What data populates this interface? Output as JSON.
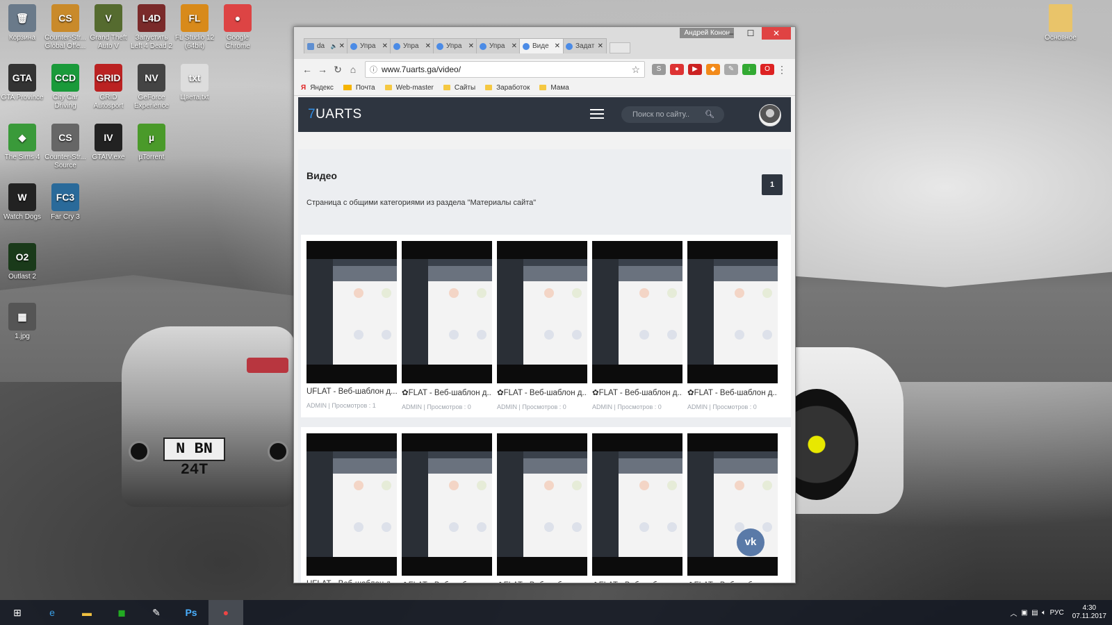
{
  "desktop": {
    "icons": [
      {
        "label": "Корзина",
        "abbr": "🗑",
        "color": "#6a7a8a"
      },
      {
        "label": "Counter-Str... Global Offe...",
        "abbr": "CS",
        "color": "#c98a2a"
      },
      {
        "label": "Grand Theft Auto V",
        "abbr": "V",
        "color": "#556b2f"
      },
      {
        "label": "Запустить Left 4 Dead 2",
        "abbr": "L4D",
        "color": "#7a2a2a"
      },
      {
        "label": "FL Studio 12 (64bit)",
        "abbr": "FL",
        "color": "#d88a1a"
      },
      {
        "label": "Google Chrome",
        "abbr": "●",
        "color": "#d44"
      },
      {
        "label": "GTA Province",
        "abbr": "GTA",
        "color": "#333"
      },
      {
        "label": "City Car Driving",
        "abbr": "CCD",
        "color": "#1a9a3a"
      },
      {
        "label": "GRID Autosport",
        "abbr": "GRID",
        "color": "#b22"
      },
      {
        "label": "GeForce Experience",
        "abbr": "NV",
        "color": "#444"
      },
      {
        "label": "Цвета.txt",
        "abbr": "txt",
        "color": "#ddd"
      },
      {
        "label": "The Sims 4",
        "abbr": "◆",
        "color": "#3a9a3a"
      },
      {
        "label": "Counter-Str... Source",
        "abbr": "CS",
        "color": "#666"
      },
      {
        "label": "GTAIV.exe",
        "abbr": "IV",
        "color": "#222"
      },
      {
        "label": "µTorrent",
        "abbr": "µ",
        "color": "#4a9a2a"
      },
      {
        "label": "Watch Dogs",
        "abbr": "W",
        "color": "#222"
      },
      {
        "label": "Far Cry 3",
        "abbr": "FC3",
        "color": "#2a6a9a"
      },
      {
        "label": "Outlast 2",
        "abbr": "O2",
        "color": "#1a3a1a"
      },
      {
        "label": "1.jpg",
        "abbr": "▦",
        "color": "#555"
      }
    ],
    "top_right_icon": "Основное"
  },
  "browser": {
    "tabs": [
      {
        "label": "da",
        "icon": "play",
        "mute": "🔈"
      },
      {
        "label": "Упра",
        "icon": "u"
      },
      {
        "label": "Упра",
        "icon": "u"
      },
      {
        "label": "Упра",
        "icon": "u"
      },
      {
        "label": "Упра",
        "icon": "u"
      },
      {
        "label": "Виде",
        "icon": "q",
        "active": true
      },
      {
        "label": "Задат",
        "icon": "u"
      }
    ],
    "user": "Андрей Конон",
    "url": "www.7uarts.ga/video/",
    "bookmarks": [
      "Яндекс",
      "Почта",
      "Web-master",
      "Сайты",
      "Заработок",
      "Мама"
    ]
  },
  "site": {
    "logo_num": "7",
    "logo_text": "UARTS",
    "search_placeholder": "Поиск по сайту..",
    "page_title": "Видео",
    "page_number": "1",
    "page_desc": "Страница с общими категориями из раздела \"Материалы сайта\"",
    "cards_row1": [
      {
        "title": "UFLAT - Веб-шаблон д...",
        "meta": "ADMIN | Просмотров : 1"
      },
      {
        "title": "✿FLAT - Веб-шаблон д...",
        "meta": "ADMIN | Просмотров : 0"
      },
      {
        "title": "✿FLAT - Веб-шаблон д...",
        "meta": "ADMIN | Просмотров : 0"
      },
      {
        "title": "✿FLAT - Веб-шаблон д...",
        "meta": "ADMIN | Просмотров : 0"
      },
      {
        "title": "✿FLAT - Веб-шаблон д...",
        "meta": "ADMIN | Просмотров : 0"
      }
    ],
    "cards_row2": [
      {
        "title": "UFLAT - Веб-шаблон д..."
      },
      {
        "title": "✿FLAT - Веб-шаблон д..."
      },
      {
        "title": "✿FLAT - Веб-шаблон д..."
      },
      {
        "title": "✿FLAT - Веб-шаблон д..."
      },
      {
        "title": "✿FLAT - Веб-шаблон д..."
      }
    ],
    "vk_label": "VK"
  },
  "taskbar": {
    "lang": "РУС",
    "time": "4:30",
    "date": "07.11.2017"
  }
}
